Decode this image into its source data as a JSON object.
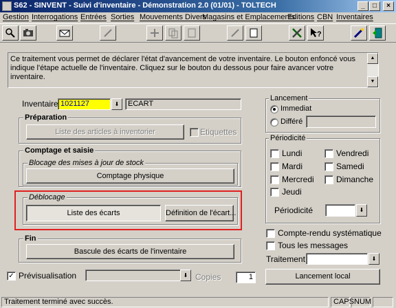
{
  "window": {
    "title": "S62 - SINVENT - Suivi d'inventaire - Démonstration 2.0 (01/01) - TOLTECH",
    "buttons": {
      "minimize": "_",
      "maximize": "□",
      "close": "×"
    }
  },
  "menu": [
    "Gestion",
    "Interrogations",
    "Entrées",
    "Sorties",
    "Mouvements Divers",
    "Magasins et Emplacements",
    "Editions",
    "CBN",
    "Inventaires"
  ],
  "toolbar": {
    "icons": [
      "search-icon",
      "camera-icon",
      "mail-icon",
      "edit-icon",
      "add-icon",
      "copy-icon",
      "delete-icon",
      "pen-icon",
      "page-icon",
      "tools-icon",
      "help-icon",
      "wand-icon",
      "exit-icon"
    ]
  },
  "info": {
    "text": "Ce traitement vous permet de déclarer l'état d'avancement de votre inventaire. Le bouton enfoncé vous indique l'étape actuelle de l'inventaire. Cliquez sur le bouton du dessous pour faire avancer votre inventaire."
  },
  "inventaire": {
    "label": "Inventaire",
    "code": "1021127",
    "description": "ECART"
  },
  "preparation": {
    "title": "Préparation",
    "liste_button": "Liste des articles à inventorier",
    "etiquettes_label": "Etiquettes"
  },
  "comptage": {
    "title": "Comptage et saisie",
    "blocage_title": "Blocage des mises à jour de stock",
    "comptage_button": "Comptage physique"
  },
  "deblocage": {
    "title": "Déblocage",
    "liste_ecarts_button": "Liste des écarts",
    "definition_button": "Définition de l'écart..."
  },
  "fin": {
    "title": "Fin",
    "bascule_button": "Bascule des écarts de l'inventaire"
  },
  "previsualisation": {
    "label": "Prévisualisation",
    "checked": true,
    "copies_label": "Copies",
    "copies_value": "1"
  },
  "lancement": {
    "title": "Lancement",
    "immediat": "Immediat",
    "differe": "Différé",
    "selected": "Immediat"
  },
  "periodicite": {
    "title": "Périodicité",
    "days": [
      "Lundi",
      "Vendredi",
      "Mardi",
      "Samedi",
      "Mercredi",
      "Dimanche",
      "Jeudi"
    ],
    "label": "Périodicité"
  },
  "options": {
    "compte_rendu": "Compte-rendu systématique",
    "tous_messages": "Tous les messages",
    "traitement_label": "Traitement"
  },
  "lancement_local_button": "Lancement local",
  "status": {
    "message": "Traitement terminé avec succès.",
    "caps": "CAPS",
    "num": "NUM"
  },
  "colors": {
    "title_start": "#0a246a",
    "title_end": "#a6caf0",
    "field_highlight": "#ffff00",
    "field_highlight_text": "#0000a0",
    "annotation": "#e02020"
  }
}
